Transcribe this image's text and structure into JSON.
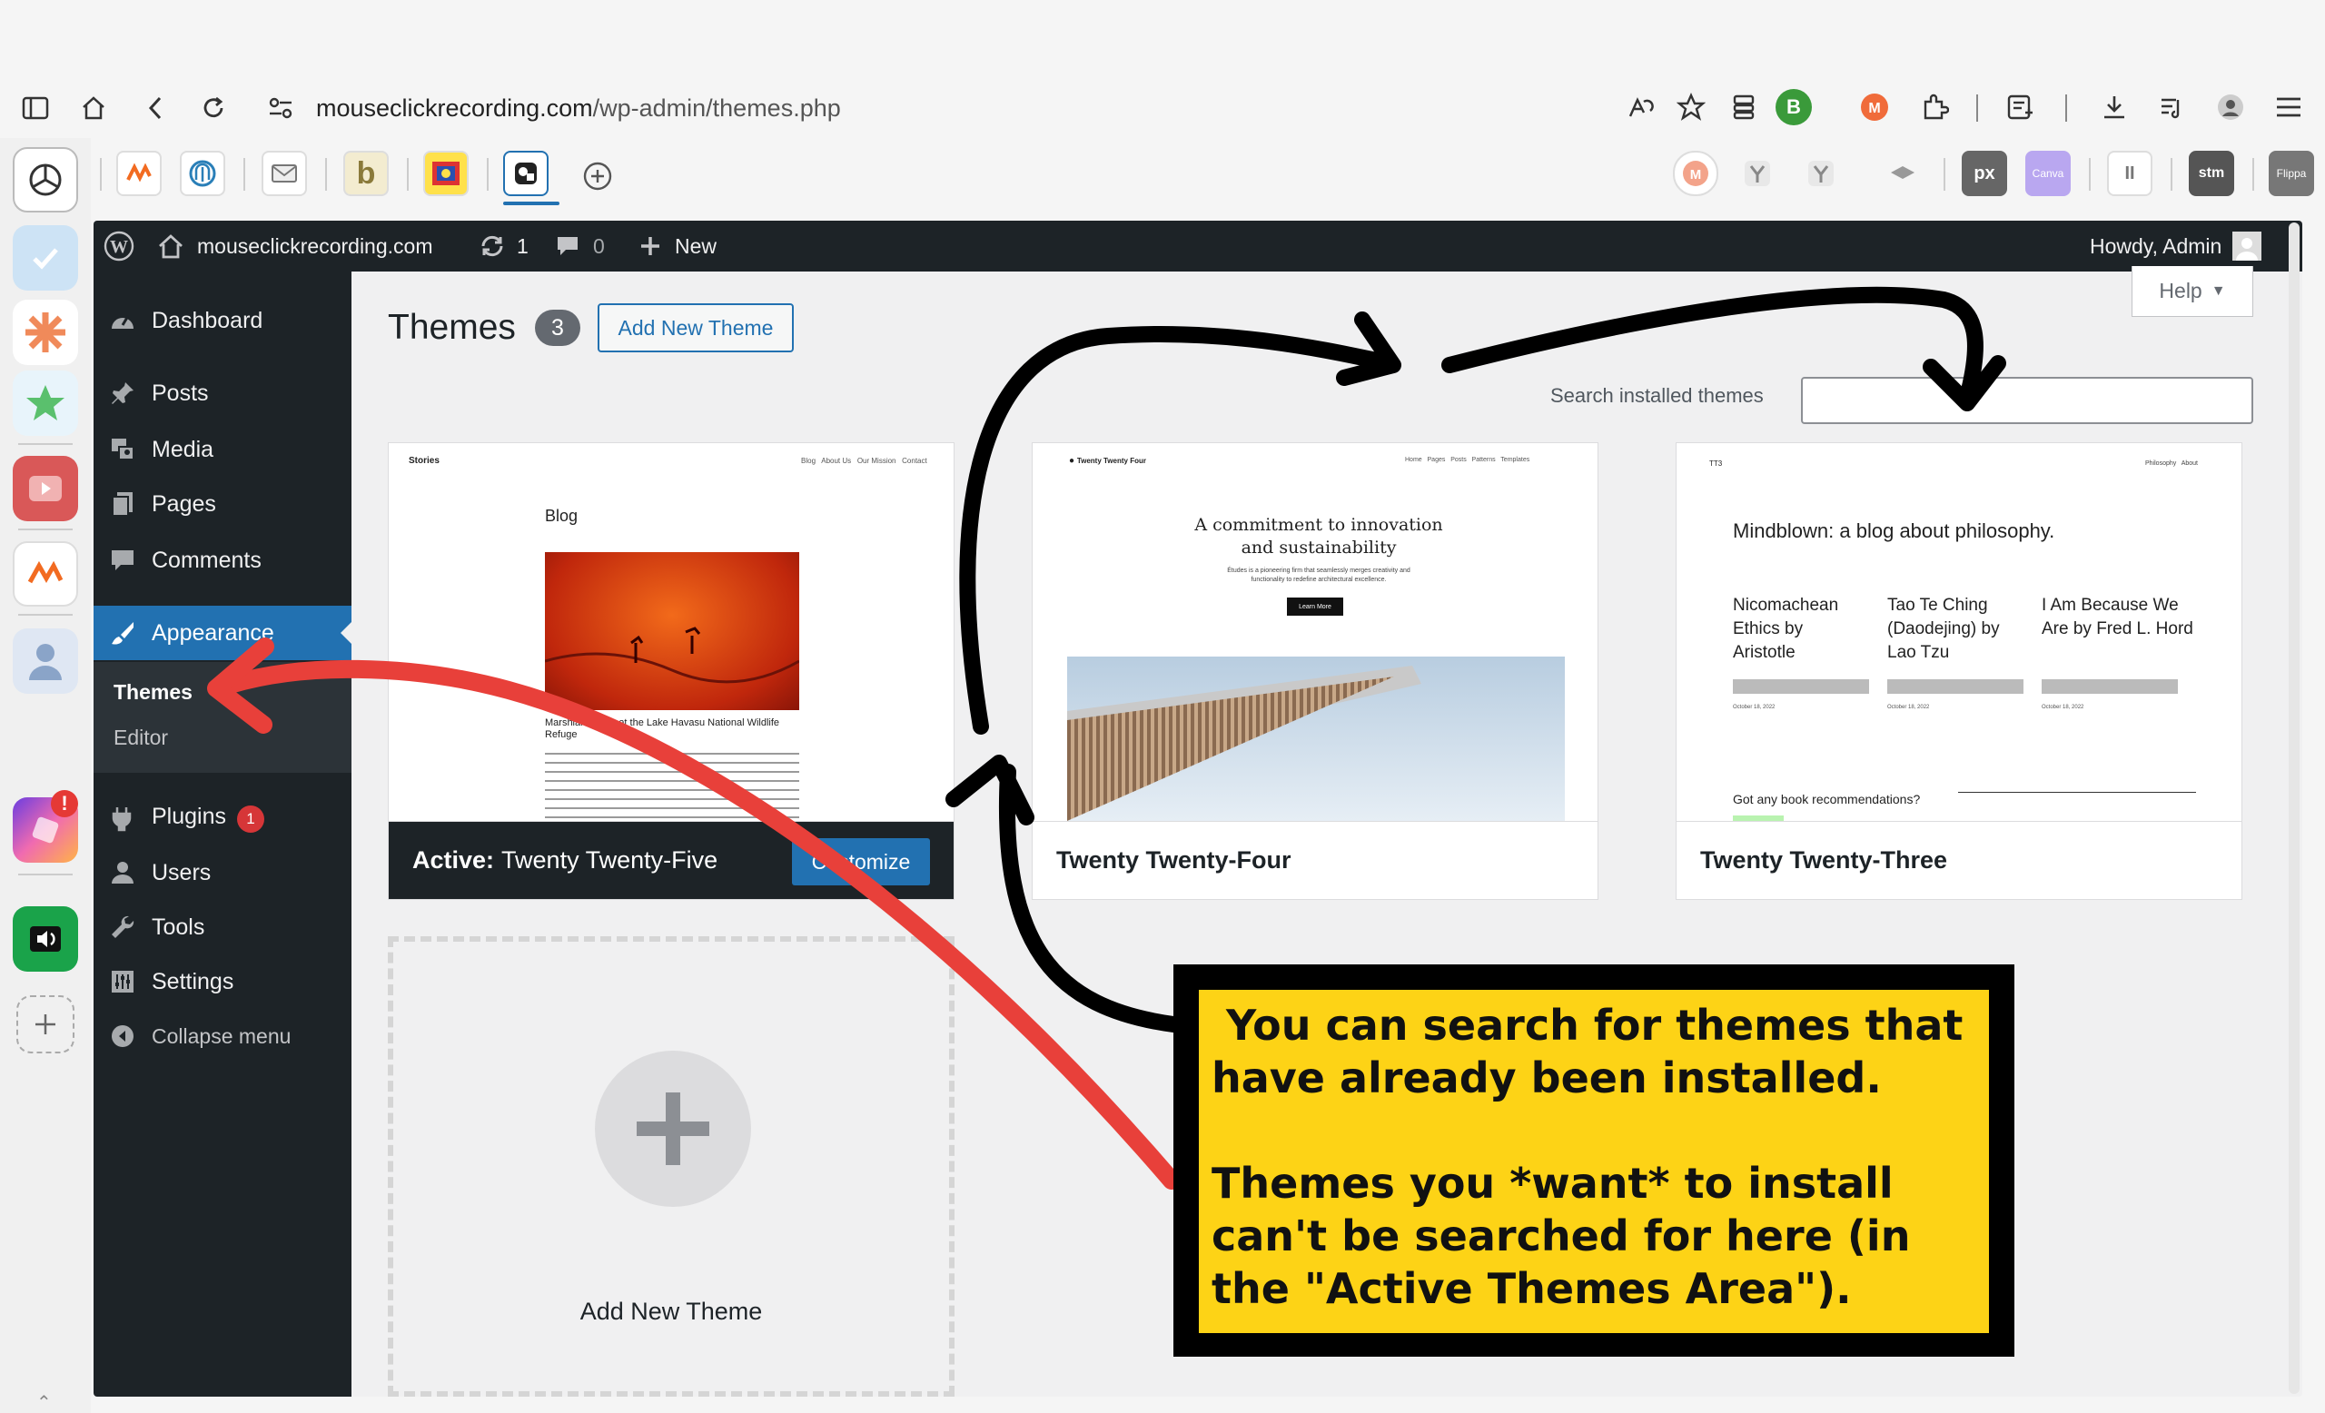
{
  "browser": {
    "url_domain": "mouseclickrecording.com",
    "url_path": "/wp-admin/themes.php",
    "profile_initial": "B"
  },
  "adminbar": {
    "site_name": "mouseclickrecording.com",
    "updates_count": "1",
    "comments_count": "0",
    "new_label": "New",
    "howdy": "Howdy, Admin"
  },
  "sidebar": {
    "items": [
      {
        "label": "Dashboard"
      },
      {
        "label": "Posts"
      },
      {
        "label": "Media"
      },
      {
        "label": "Pages"
      },
      {
        "label": "Comments"
      },
      {
        "label": "Appearance"
      },
      {
        "label": "Plugins",
        "badge": "1"
      },
      {
        "label": "Users"
      },
      {
        "label": "Tools"
      },
      {
        "label": "Settings"
      },
      {
        "label": "Collapse menu"
      }
    ],
    "submenu": [
      {
        "label": "Themes"
      },
      {
        "label": "Editor"
      }
    ]
  },
  "page": {
    "title": "Themes",
    "count": "3",
    "add_new_label": "Add New Theme",
    "help_label": "Help",
    "search_label": "Search installed themes",
    "search_value": ""
  },
  "themes": [
    {
      "active_prefix": "Active:",
      "name": "Twenty Twenty-Five",
      "customize_label": "Customize",
      "shot": {
        "site": "Stories",
        "nav": "Blog   About Us   Our Mission   Contact",
        "heading": "Blog",
        "caption": "Marshland birds at the Lake Havasu National Wildlife Refuge"
      }
    },
    {
      "name": "Twenty Twenty-Four",
      "shot": {
        "site": "Twenty Twenty Four",
        "nav": "Home   Pages   Posts   Patterns   Templates",
        "heading": "A commitment to innovation and sustainability",
        "sub": "Études is a pioneering firm that seamlessly merges creativity and functionality to redefine architectural excellence.",
        "btn": "Learn More"
      }
    },
    {
      "name": "Twenty Twenty-Three",
      "shot": {
        "site": "TT3",
        "nav": "Philosophy   About",
        "heading": "Mindblown: a blog about philosophy.",
        "col1": "Nicomachean Ethics by Aristotle",
        "col2": "Tao Te Ching (Daodejing) by Lao Tzu",
        "col3": "I Am Because We Are by Fred L. Hord",
        "date": "October 18, 2022",
        "footer": "Got any book recommendations?"
      }
    }
  ],
  "add_card": {
    "label": "Add New Theme"
  },
  "callout": {
    "text": " You can search for themes that have already been installed.\n\nThemes you *want* to install can't be searched for here (in the \"Active Themes Area\")."
  },
  "colors": {
    "wp_dark": "#1d2327",
    "wp_blue": "#2271b1",
    "callout_yellow": "#fdd316",
    "arrow_red": "#e8403a"
  }
}
